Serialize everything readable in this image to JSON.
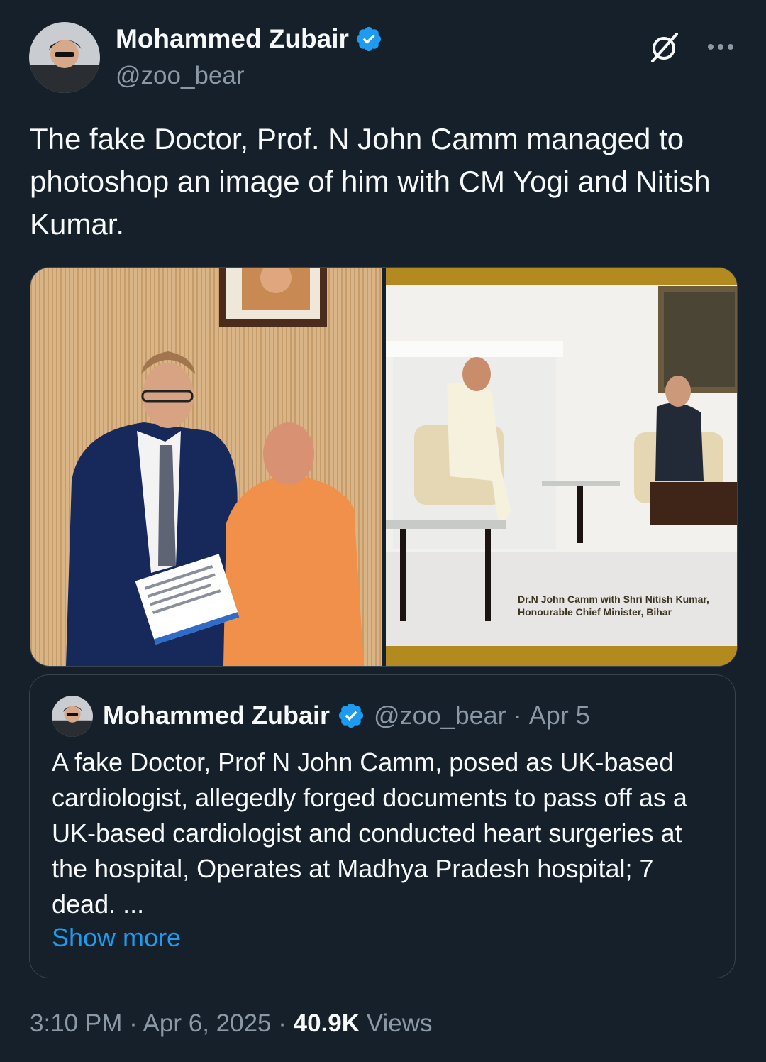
{
  "author": {
    "display_name": "Mohammed Zubair",
    "handle": "@zoo_bear"
  },
  "tweet": {
    "text": "The fake Doctor, Prof. N John Camm managed to photoshop an image of him with CM Yogi and Nitish Kumar.",
    "media_right_caption_line1": "Dr.N John Camm with Shri Nitish Kumar,",
    "media_right_caption_line2": "Honourable Chief Minister, Bihar"
  },
  "quote": {
    "display_name": "Mohammed Zubair",
    "handle": "@zoo_bear",
    "separator": "·",
    "date": "Apr 5",
    "text": "A fake Doctor, Prof N John Camm, posed as UK-based cardiologist, allegedly forged documents to pass off as a UK-based cardiologist and conducted heart surgeries at the hospital, Operates at Madhya Pradesh hospital; 7 dead. ...",
    "show_more": "Show more"
  },
  "meta": {
    "time": "3:10 PM",
    "sep1": " · ",
    "date": "Apr 6, 2025",
    "sep2": " · ",
    "views_count": "40.9K",
    "views_label": " Views"
  },
  "colors": {
    "background": "#15202b",
    "text_primary": "#f7f9f9",
    "text_secondary": "#8b98a5",
    "accent": "#1d9bf0",
    "border": "#38444d"
  },
  "icons": {
    "verified": "verified-badge-icon",
    "grok": "grok-icon",
    "more": "more-options-icon"
  }
}
